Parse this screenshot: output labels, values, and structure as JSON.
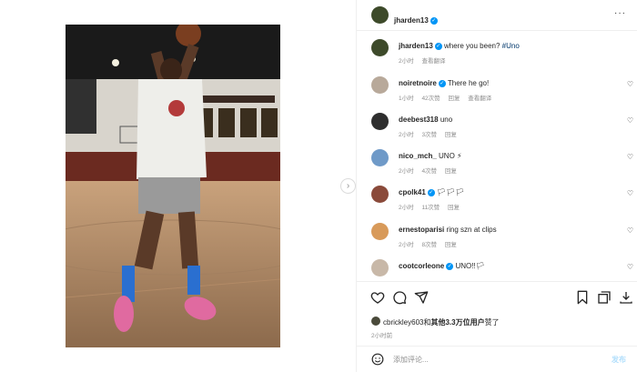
{
  "header": {
    "username": "jharden13",
    "more_icon": "more-horizontal-icon"
  },
  "caption": {
    "username": "jharden13",
    "text": "where you been? ",
    "hashtag": "#Uno",
    "time": "2小时",
    "translate": "查看翻译"
  },
  "comments": [
    {
      "username": "noiretnoire",
      "verified": true,
      "text": "There he go!",
      "time": "1小时",
      "likes": "42次赞",
      "reply": "回复",
      "translate": "查看翻译"
    },
    {
      "username": "deebest318",
      "verified": false,
      "text": "uno",
      "time": "2小时",
      "likes": "3次赞",
      "reply": "回复",
      "translate": ""
    },
    {
      "username": "nico_mch_",
      "verified": false,
      "text": "UNO ⚡",
      "time": "2小时",
      "likes": "4次赞",
      "reply": "回复",
      "translate": ""
    },
    {
      "username": "cpolk41",
      "verified": true,
      "text": "🏳🏳🏳",
      "time": "2小时",
      "likes": "11次赞",
      "reply": "回复",
      "translate": ""
    },
    {
      "username": "ernestoparisi",
      "verified": false,
      "text": "ring szn at clips",
      "time": "2小时",
      "likes": "8次赞",
      "reply": "回复",
      "translate": ""
    },
    {
      "username": "cootcorleone",
      "verified": true,
      "text": "UNO!!🏳",
      "time": "2小时",
      "likes": "",
      "reply": "",
      "translate": ""
    }
  ],
  "likes": {
    "user": "cbrickley603",
    "connector": "和",
    "others": "其他3.3万位用户",
    "suffix": "赞了"
  },
  "post_time": "2小时前",
  "add_comment": {
    "placeholder": "添加评论...",
    "post_label": "发布"
  },
  "icons": {
    "like": "heart-icon",
    "comment": "comment-icon",
    "share": "send-icon",
    "save": "bookmark-icon",
    "embed": "embed-icon",
    "download": "download-icon",
    "emoji": "emoji-icon",
    "next": "chevron-right-icon"
  },
  "colors": {
    "verified": "#0095f6",
    "link": "#00376b",
    "muted": "#8e8e8e",
    "post_button": "#b2dffc"
  }
}
